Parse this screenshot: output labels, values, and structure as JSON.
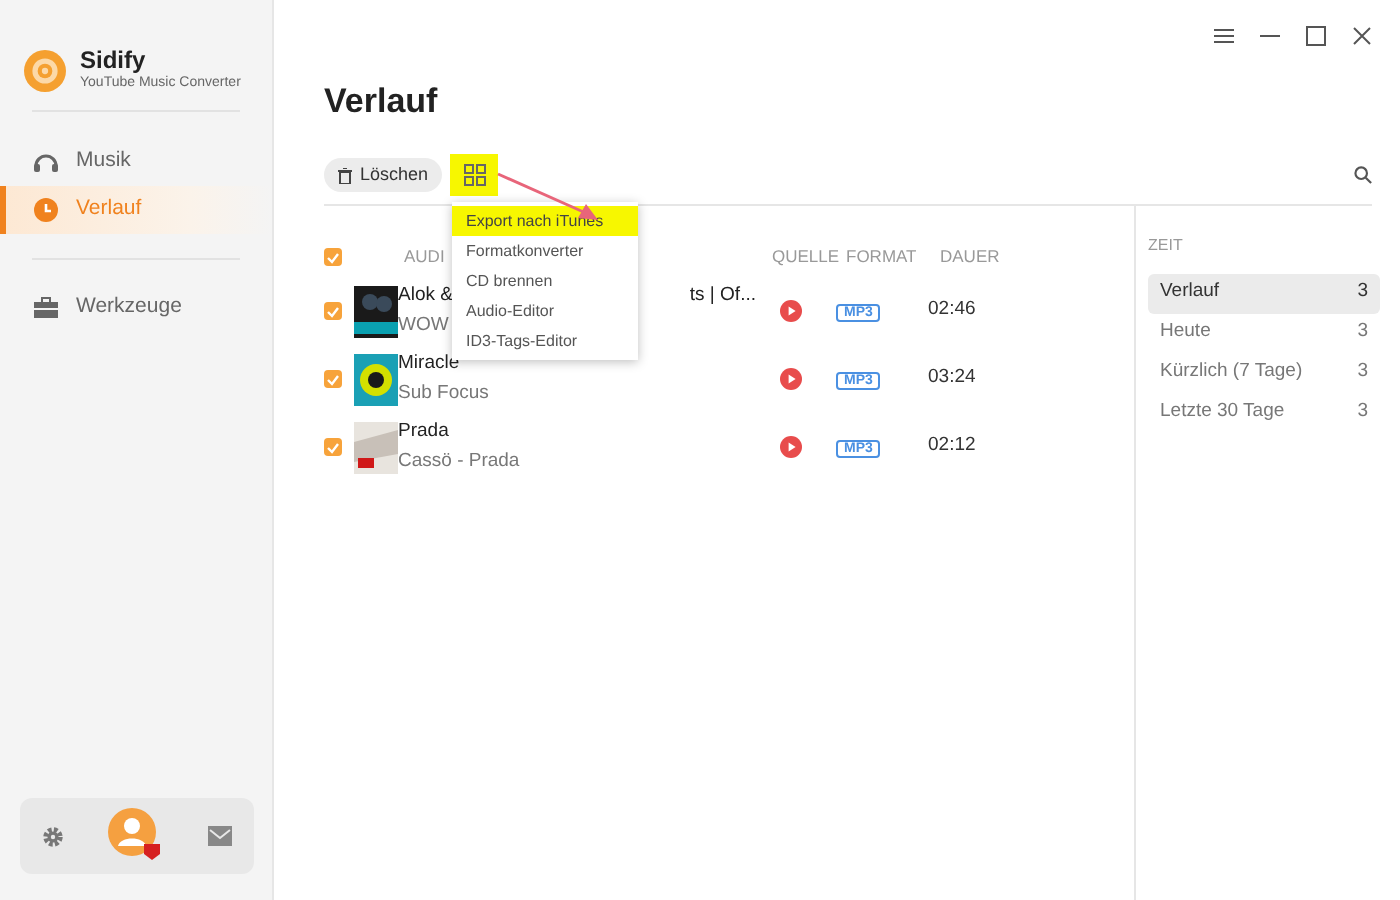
{
  "app": {
    "name": "Sidify",
    "subtitle": "YouTube Music Converter"
  },
  "nav": [
    {
      "label": "Musik",
      "selected": false
    },
    {
      "label": "Verlauf",
      "selected": true
    },
    {
      "label": "Werkzeuge",
      "selected": false
    }
  ],
  "page_title": "Verlauf",
  "toolbar": {
    "delete_button": "Löschen",
    "tools_highlighted": true
  },
  "tools_menu": [
    {
      "label": "Export nach iTunes",
      "highlighted": true
    },
    {
      "label": "Formatkonverter",
      "highlighted": false
    },
    {
      "label": "CD brennen",
      "highlighted": false
    },
    {
      "label": "Audio-Editor",
      "highlighted": false
    },
    {
      "label": "ID3-Tags-Editor",
      "highlighted": false
    }
  ],
  "table": {
    "select_all_checked": true,
    "columns": [
      "AUDI",
      "QUELLE",
      "FORMAT",
      "DAUER"
    ],
    "rows": [
      {
        "checked": true,
        "title": "Alok &",
        "title_tail": "ts | Of...",
        "artist": "WOW",
        "format": "MP3",
        "duration": "02:46"
      },
      {
        "checked": true,
        "title": "Miracle",
        "artist": "Sub Focus",
        "format": "MP3",
        "duration": "03:24"
      },
      {
        "checked": true,
        "title": "Prada",
        "artist": "Cassö - Prada",
        "format": "MP3",
        "duration": "02:12"
      }
    ]
  },
  "filters": {
    "heading": "ZEIT",
    "items": [
      {
        "label": "Verlauf",
        "count": "3",
        "selected": true
      },
      {
        "label": "Heute",
        "count": "3",
        "selected": false
      },
      {
        "label": "Kürzlich (7 Tage)",
        "count": "3",
        "selected": false
      },
      {
        "label": "Letzte 30 Tage",
        "count": "3",
        "selected": false
      }
    ]
  }
}
